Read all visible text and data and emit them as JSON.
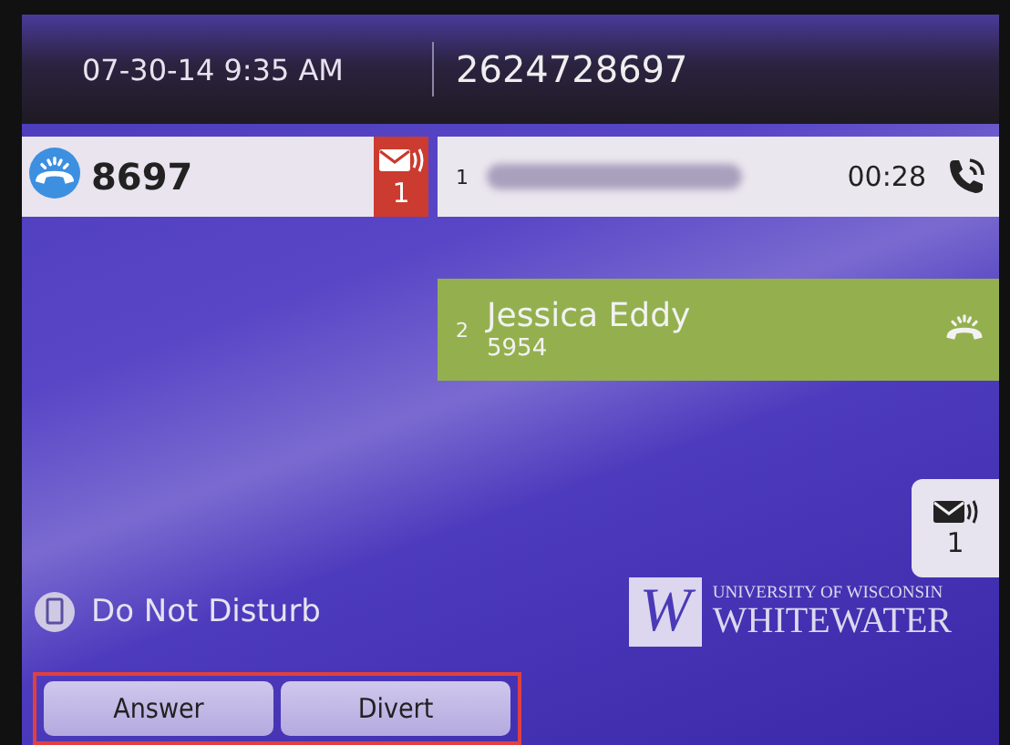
{
  "header": {
    "date_time": "07-30-14 9:35 AM",
    "phone_number": "2624728697"
  },
  "line": {
    "number": "8697",
    "voicemail_count": "1"
  },
  "calls": [
    {
      "kind": "active",
      "index": "1",
      "caller_redacted": true,
      "timer": "00:28"
    },
    {
      "kind": "ringing",
      "index": "2",
      "name": "Jessica Eddy",
      "extension": "5954"
    }
  ],
  "voicemail_tab": {
    "count": "1"
  },
  "do_not_disturb": {
    "label": "Do Not Disturb"
  },
  "logo": {
    "mark": "W",
    "line_1": "UNIVERSITY OF WISCONSIN",
    "line_2": "WHITEWATER"
  },
  "softkeys": [
    {
      "label": "Answer"
    },
    {
      "label": "Divert"
    }
  ]
}
